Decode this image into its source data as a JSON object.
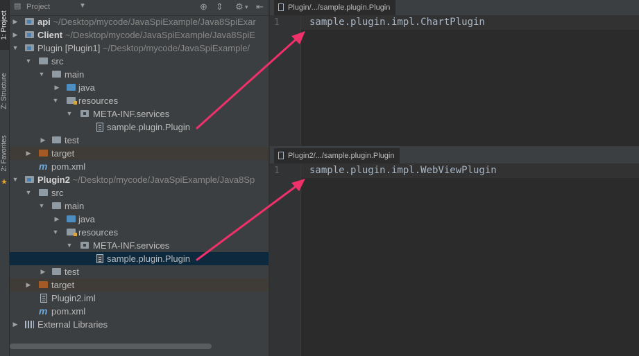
{
  "side_tabs": [
    {
      "label": "1: Project"
    },
    {
      "label": "Z: Structure"
    },
    {
      "label": "2: Favorites"
    }
  ],
  "project_pane": {
    "title": "Project",
    "tree": [
      {
        "label": "api",
        "path": "~/Desktop/mycode/JavaSpiExample/Java8SpiExar",
        "bold": true
      },
      {
        "label": "Client",
        "path": "~/Desktop/mycode/JavaSpiExample/Java8SpiE",
        "bold": true
      },
      {
        "label": "Plugin [Plugin1]",
        "path": "~/Desktop/mycode/JavaSpiExample/"
      },
      {
        "label": "src"
      },
      {
        "label": "main"
      },
      {
        "label": "java"
      },
      {
        "label": "resources"
      },
      {
        "label": "META-INF.services"
      },
      {
        "label": "sample.plugin.Plugin"
      },
      {
        "label": "test"
      },
      {
        "label": "target"
      },
      {
        "label": "pom.xml"
      },
      {
        "label": "Plugin2",
        "path": "~/Desktop/mycode/JavaSpiExample/Java8Sp",
        "bold": true
      },
      {
        "label": "src"
      },
      {
        "label": "main"
      },
      {
        "label": "java"
      },
      {
        "label": "resources"
      },
      {
        "label": "META-INF.services"
      },
      {
        "label": "sample.plugin.Plugin"
      },
      {
        "label": "test"
      },
      {
        "label": "target"
      },
      {
        "label": "Plugin2.iml"
      },
      {
        "label": "pom.xml"
      },
      {
        "label": "External Libraries"
      }
    ]
  },
  "editor_top": {
    "tab_label": "Plugin/.../sample.plugin.Plugin",
    "line_number": "1",
    "code": "sample.plugin.impl.ChartPlugin"
  },
  "editor_bottom": {
    "tab_label": "Plugin2/.../sample.plugin.Plugin",
    "line_number": "1",
    "code": "sample.plugin.impl.WebViewPlugin"
  },
  "colors": {
    "annotation_arrow": "#f0306a"
  }
}
